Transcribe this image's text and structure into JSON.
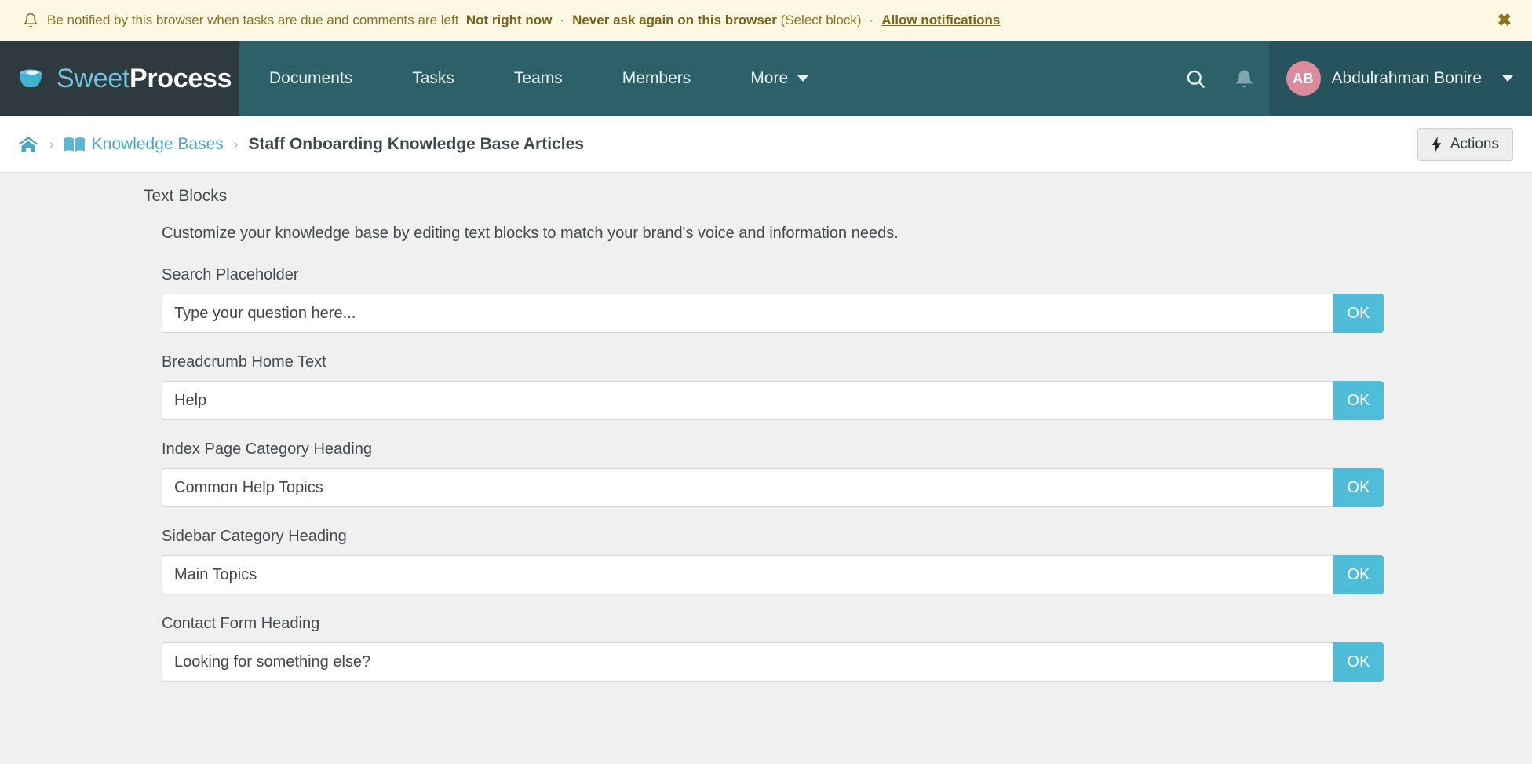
{
  "notification": {
    "icon": "bell-icon",
    "message": "Be notified by this browser when tasks are due and comments are left",
    "not_now": "Not right now",
    "separator": "·",
    "never_ask": "Never ask again on this browser",
    "select_block": "(Select block)",
    "allow": "Allow notifications",
    "close": "✖"
  },
  "brand": {
    "icon": "coffee-cup-icon",
    "name_light": "Sweet",
    "name_bold": "Process"
  },
  "nav": {
    "items": [
      {
        "label": "Documents"
      },
      {
        "label": "Tasks"
      },
      {
        "label": "Teams"
      },
      {
        "label": "Members"
      },
      {
        "label": "More",
        "has_caret": true
      }
    ],
    "search_icon": "search-icon",
    "bell_icon": "bell-icon",
    "user": {
      "initials": "AB",
      "name": "Abdulrahman Bonire",
      "avatar_color": "#dd8a9c"
    }
  },
  "breadcrumb": {
    "home_icon": "home-icon",
    "separator": "›",
    "book_icon": "book-icon",
    "link": "Knowledge Bases",
    "current": "Staff Onboarding Knowledge Base Articles",
    "actions_label": "Actions",
    "actions_icon": "lightning-bolt-icon"
  },
  "content": {
    "section_title": "Text Blocks",
    "description": "Customize your knowledge base by editing text blocks to match your brand's voice and information needs.",
    "ok_label": "OK",
    "fields": [
      {
        "label": "Search Placeholder",
        "value": "Type your question here...",
        "placeholder": "Type your question here..."
      },
      {
        "label": "Breadcrumb Home Text",
        "value": "Help",
        "placeholder": "Help"
      },
      {
        "label": "Index Page Category Heading",
        "value": "Common Help Topics",
        "placeholder": "Common Help Topics"
      },
      {
        "label": "Sidebar Category Heading",
        "value": "Main Topics",
        "placeholder": "Main Topics"
      },
      {
        "label": "Contact Form Heading",
        "value": "Looking for something else?",
        "placeholder": "Looking for something else?"
      }
    ]
  },
  "colors": {
    "notif_bg": "#fdf8e3",
    "notif_text": "#8a7321",
    "nav_bg": "#2d6169",
    "brand_bg": "#2f3a40",
    "user_bg": "#27545c",
    "accent_teal": "#4aa8c6",
    "ok_button": "#4fbcd8",
    "page_bg": "#f0f0f0"
  }
}
